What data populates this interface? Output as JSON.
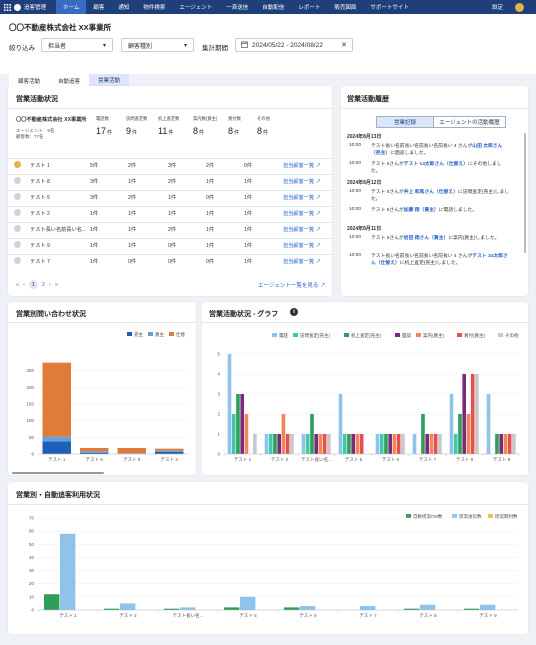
{
  "topbar": {
    "brand": "追客管理",
    "nav": [
      "ホーム",
      "顧客",
      "通知",
      "物件検索",
      "エージェント",
      "一斉送信",
      "自動配信",
      "レポート",
      "販売図面",
      "サポートサイト"
    ],
    "active_index": 0,
    "settings": "設定"
  },
  "header": {
    "company": "〇〇不動産株式会社 XX事業所",
    "filter_label": "絞り込み",
    "filter_value": "担当者",
    "customer_type": "顧客種別",
    "period_label": "集計期間",
    "period_value": "2024/05/22 - 2024/08/22",
    "tabs": [
      "顧客活動",
      "自動追客",
      "営業活動"
    ],
    "active_tab": 2
  },
  "sales_status": {
    "title": "営業活動状況",
    "company": "〇〇不動産株式会社 XX事業所",
    "agents": "エージェント：8名",
    "customers": "顧客数：77名",
    "kpis": [
      {
        "label": "電話数",
        "value": "17",
        "unit": "件"
      },
      {
        "label": "訪問査定数",
        "value": "9",
        "unit": "件"
      },
      {
        "label": "机上査定数",
        "value": "11",
        "unit": "件"
      },
      {
        "label": "案内数(買主)",
        "value": "8",
        "unit": "件"
      },
      {
        "label": "買付数",
        "value": "8",
        "unit": "件"
      },
      {
        "label": "その他",
        "value": "8",
        "unit": "件"
      }
    ],
    "rows": [
      {
        "name": "テスト 1",
        "c": [
          "5件",
          "2件",
          "3件",
          "2件",
          "0件"
        ],
        "avatar": "photo"
      },
      {
        "name": "テスト 8",
        "c": [
          "3件",
          "1件",
          "2件",
          "1件",
          "1件"
        ],
        "avatar": "default"
      },
      {
        "name": "テスト 5",
        "c": [
          "3件",
          "2件",
          "1件",
          "0件",
          "1件"
        ],
        "avatar": "default"
      },
      {
        "name": "テスト 2",
        "c": [
          "1件",
          "1件",
          "1件",
          "1件",
          "1件"
        ],
        "avatar": "default"
      },
      {
        "name": "テスト長い名前長い名...",
        "c": [
          "1件",
          "1件",
          "2件",
          "1件",
          "1件"
        ],
        "avatar": "default"
      },
      {
        "name": "テスト 9",
        "c": [
          "1件",
          "1件",
          "0件",
          "1件",
          "1件"
        ],
        "avatar": "default"
      },
      {
        "name": "テスト 7",
        "c": [
          "1件",
          "0件",
          "0件",
          "0件",
          "1件"
        ],
        "avatar": "default"
      }
    ],
    "row_link": "担当顧客一覧",
    "pages": [
      "«",
      "‹",
      "1",
      "2",
      "›",
      "»"
    ],
    "active_page": "1",
    "more_link": "エージェント一覧を見る"
  },
  "history": {
    "title": "営業活動履歴",
    "tabs": [
      "営業記録",
      "エージェントの活動履歴"
    ],
    "entries": [
      {
        "date": "2024年8月13日"
      },
      {
        "time": "10:00",
        "pre": "テスト長い名前長い名前長い名前長い 4 さんが",
        "link": "山田 太郎さん（売主）",
        "post": "に面談しました。"
      },
      {
        "time": "10:00",
        "pre": "テスト 5さんが",
        "link": "テスト 14太郎さん（仕替え）",
        "post": "にその他しました。"
      },
      {
        "date": "2024年8月12日"
      },
      {
        "time": "10:00",
        "pre": "テスト 5さんが",
        "link": "井上 和馬さん（仕替え）",
        "post": "に訪問査定(売主)しました。"
      },
      {
        "time": "10:00",
        "pre": "テスト 5さんが",
        "link": "加藤 翔（買主）",
        "post": "に電話しました。"
      },
      {
        "date": "2024年8月11日"
      },
      {
        "time": "10:00",
        "pre": "テスト 5さんが",
        "link": "岩田 翔さん（買主）",
        "post": "に案内(買主)しました。"
      },
      {
        "time": "10:00",
        "pre": "テスト長い名前長い名前長い名前長い 4 さんが",
        "link": "テスト 34太郎さん（仕替え）",
        "post": "に机上査定(売主)しました。"
      }
    ]
  },
  "inquiry": {
    "title": "営業別問い合わせ状況",
    "legend": [
      "売主",
      "買主",
      "仕替"
    ],
    "colors": {
      "売主": "#1f5fb8",
      "買主": "#5fa2de",
      "仕替": "#e07b3a"
    }
  },
  "sales_graph": {
    "title": "営業活動状況 - グラフ",
    "legend": [
      "電話",
      "訪問査定(売主)",
      "机上査定(売主)",
      "面談",
      "案内(買主)",
      "買付(買主)",
      "その他"
    ]
  },
  "auto_usage": {
    "title": "営業別・自動追客利用状況",
    "legend": [
      "自動提案ON数",
      "提案送信数",
      "提案開封数"
    ]
  },
  "chart_data": [
    {
      "type": "bar",
      "title": "営業別問い合わせ状況",
      "stacked": true,
      "categories": [
        "テスト 1",
        "テスト 5",
        "テスト 9",
        "テスト 2"
      ],
      "series": [
        {
          "name": "売主",
          "values": [
            38,
            4,
            1,
            6
          ],
          "color": "#1f5fb8"
        },
        {
          "name": "買主",
          "values": [
            14,
            4,
            1,
            4
          ],
          "color": "#5fa2de"
        },
        {
          "name": "仕替",
          "values": [
            222,
            10,
            16,
            6
          ],
          "color": "#e07b3a"
        }
      ],
      "ylim": [
        0,
        300
      ],
      "yticks": [
        0,
        50,
        100,
        150,
        200,
        250
      ],
      "legend": "top-right"
    },
    {
      "type": "bar",
      "title": "営業活動状況 - グラフ",
      "categories": [
        "テスト 1",
        "テスト 2",
        "テスト長い名...",
        "テスト 5",
        "テスト 6",
        "テスト 7",
        "テスト 8",
        "テスト 9"
      ],
      "series": [
        {
          "name": "電話",
          "values": [
            5,
            1,
            1,
            3,
            1,
            1,
            3,
            3
          ],
          "color": "#8fc3ea"
        },
        {
          "name": "訪問査定(売主)",
          "values": [
            2,
            1,
            1,
            1,
            1,
            0,
            1,
            0
          ],
          "color": "#3fc9a8"
        },
        {
          "name": "机上査定(売主)",
          "values": [
            3,
            1,
            2,
            1,
            1,
            2,
            2,
            1
          ],
          "color": "#2e9e5a"
        },
        {
          "name": "面談",
          "values": [
            3,
            1,
            1,
            1,
            1,
            1,
            4,
            1
          ],
          "color": "#7a2a7a"
        },
        {
          "name": "案内(買主)",
          "values": [
            2,
            2,
            1,
            1,
            1,
            1,
            2,
            1
          ],
          "color": "#f0875a"
        },
        {
          "name": "買付(買主)",
          "values": [
            0,
            1,
            1,
            1,
            1,
            1,
            4,
            1
          ],
          "color": "#e45050"
        },
        {
          "name": "その他",
          "values": [
            1,
            1,
            1,
            0,
            1,
            1,
            4,
            1
          ],
          "color": "#c8c8c8"
        }
      ],
      "ylim": [
        0,
        5
      ],
      "yticks": [
        0,
        1,
        2,
        3,
        4,
        5
      ],
      "legend": "top-right"
    },
    {
      "type": "bar",
      "title": "営業別・自動追客利用状況",
      "categories": [
        "テスト 1",
        "テスト 2",
        "テスト長い名...",
        "テスト 5",
        "テスト 6",
        "テスト 7",
        "テスト 8",
        "テスト 9"
      ],
      "series": [
        {
          "name": "自動提案ON数",
          "values": [
            12,
            1,
            1,
            2,
            2,
            0,
            1,
            1
          ],
          "color": "#2e9e5a"
        },
        {
          "name": "提案送信数",
          "values": [
            58,
            5,
            2,
            10,
            3,
            3,
            4,
            4
          ],
          "color": "#8fc3ea"
        },
        {
          "name": "提案開封数",
          "values": [
            0,
            0,
            0,
            0,
            0,
            0,
            0,
            0
          ],
          "color": "#f0c24a"
        }
      ],
      "ylim": [
        0,
        70
      ],
      "yticks": [
        0,
        10,
        20,
        30,
        40,
        50,
        60,
        70
      ],
      "legend": "top-right"
    }
  ]
}
